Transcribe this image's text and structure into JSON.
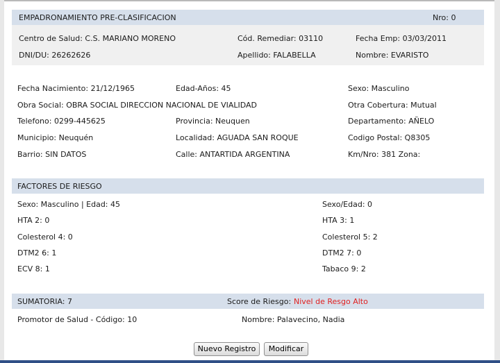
{
  "header": {
    "title": "EMPADRONAMIENTO PRE-CLASIFICACION",
    "nro": "Nro: 0"
  },
  "summary": {
    "centro": "Centro de Salud: C.S. MARIANO MORENO",
    "cod_remediar": "Cód. Remediar: 03110",
    "fecha_emp": "Fecha Emp: 03/03/2011",
    "dni": "DNI/DU: 26262626",
    "apellido": "Apellido: FALABELLA",
    "nombre": "Nombre: EVARISTO"
  },
  "personal": {
    "fecha_nac": "Fecha Nacimiento: 21/12/1965",
    "edad": "Edad-Años: 45",
    "sexo": "Sexo: Masculino",
    "obra_social": "Obra Social: OBRA SOCIAL DIRECCION NACIONAL DE VIALIDAD",
    "otra_cobertura": "Otra Cobertura: Mutual",
    "telefono": "Telefono: 0299-445625",
    "provincia": "Provincia: Neuquen",
    "departamento": "Departamento: AÑELO",
    "municipio": "Municipio: Neuquén",
    "localidad": "Localidad: AGUADA SAN ROQUE",
    "codigo_postal": "Codigo Postal: Q8305",
    "barrio": "Barrio: SIN DATOS",
    "calle": "Calle: ANTARTIDA ARGENTINA",
    "km": "Km/Nro: 381 Zona:"
  },
  "risk": {
    "title": "FACTORES DE RIESGO",
    "left": [
      "Sexo: Masculino | Edad: 45",
      "HTA 2: 0",
      "Colesterol 4: 0",
      "DTM2 6: 1",
      "ECV 8: 1"
    ],
    "right": [
      "Sexo/Edad: 0",
      "HTA 3: 1",
      "Colesterol 5: 2",
      "DTM2 7: 0",
      "Tabaco 9: 2"
    ]
  },
  "sum": {
    "sumatoria": "SUMATORIA: 7",
    "score_label": "Score de Riesgo:",
    "score_value": "Nivel de Resgo Alto",
    "score_color": "#e02020",
    "promotor": "Promotor de Salud - Código: 10",
    "promotor_nombre": "Nombre: Palavecino, Nadia"
  },
  "buttons": {
    "nuevo": "Nuevo Registro",
    "modificar": "Modificar"
  }
}
